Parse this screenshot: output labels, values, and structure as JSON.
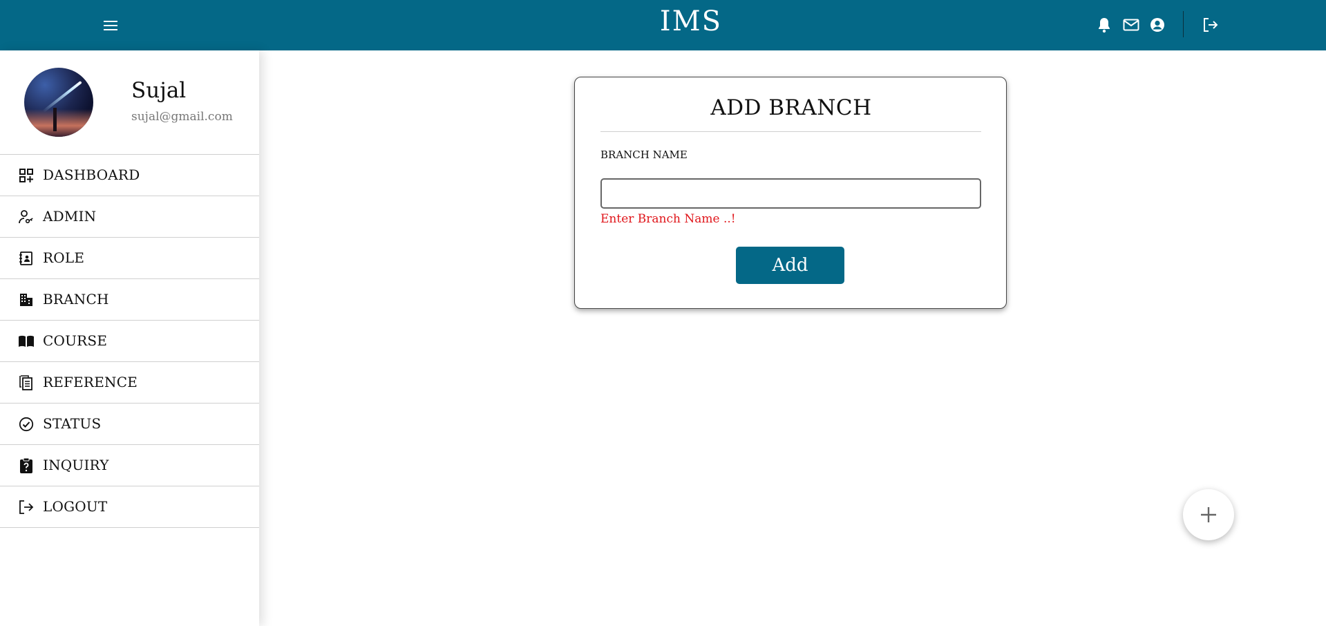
{
  "app": {
    "title": "IMS"
  },
  "topbar": {
    "menu_icon": "hamburger-menu-icon",
    "icons": [
      "bell-icon",
      "mail-icon",
      "user-circle-icon",
      "logout-icon"
    ]
  },
  "profile": {
    "name": "Sujal",
    "email": "sujal@gmail.com"
  },
  "sidebar": {
    "items": [
      {
        "label": "DASHBOARD",
        "icon": "dashboard-icon"
      },
      {
        "label": "ADMIN",
        "icon": "admin-key-icon"
      },
      {
        "label": "ROLE",
        "icon": "contact-book-icon"
      },
      {
        "label": "BRANCH",
        "icon": "building-icon"
      },
      {
        "label": "COURSE",
        "icon": "book-icon"
      },
      {
        "label": "REFERENCE",
        "icon": "document-copy-icon"
      },
      {
        "label": "STATUS",
        "icon": "check-circle-icon"
      },
      {
        "label": "INQUIRY",
        "icon": "clipboard-question-icon"
      },
      {
        "label": "LOGOUT",
        "icon": "logout-icon"
      }
    ]
  },
  "form": {
    "title": "ADD BRANCH",
    "field_label": "BRANCH NAME",
    "field_value": "",
    "error": "Enter Branch Name ..!",
    "submit_label": "Add"
  },
  "fab": {
    "icon": "plus-icon"
  },
  "colors": {
    "primary": "#046887",
    "error": "#e0161b",
    "divider": "#cfcfcf"
  }
}
